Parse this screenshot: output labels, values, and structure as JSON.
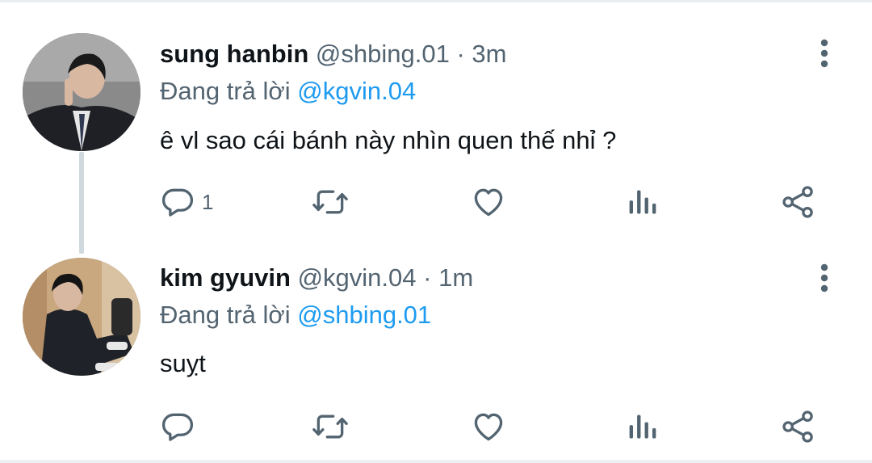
{
  "tweets": [
    {
      "name": "sung hanbin",
      "handle": "@shbing.01",
      "separator": "·",
      "time": "3m",
      "reply_prefix": "Đang trả lời",
      "reply_to": "@kgvin.04",
      "text": "ê vl sao cái bánh này nhìn quen thế nhỉ ?",
      "reply_count": "1",
      "icons": [
        "reply-icon",
        "retweet-icon",
        "like-icon",
        "views-icon",
        "share-icon",
        "more-icon"
      ]
    },
    {
      "name": "kim gyuvin",
      "handle": "@kgvin.04",
      "separator": "·",
      "time": "1m",
      "reply_prefix": "Đang trả lời",
      "reply_to": "@shbing.01",
      "text": "suỵt",
      "reply_count": "",
      "icons": [
        "reply-icon",
        "retweet-icon",
        "like-icon",
        "views-icon",
        "share-icon",
        "more-icon"
      ]
    }
  ],
  "colors": {
    "text_primary": "#0f1419",
    "text_secondary": "#536471",
    "mention": "#1d9bf0",
    "icon": "#536471",
    "thread_line": "#cfd9de"
  }
}
